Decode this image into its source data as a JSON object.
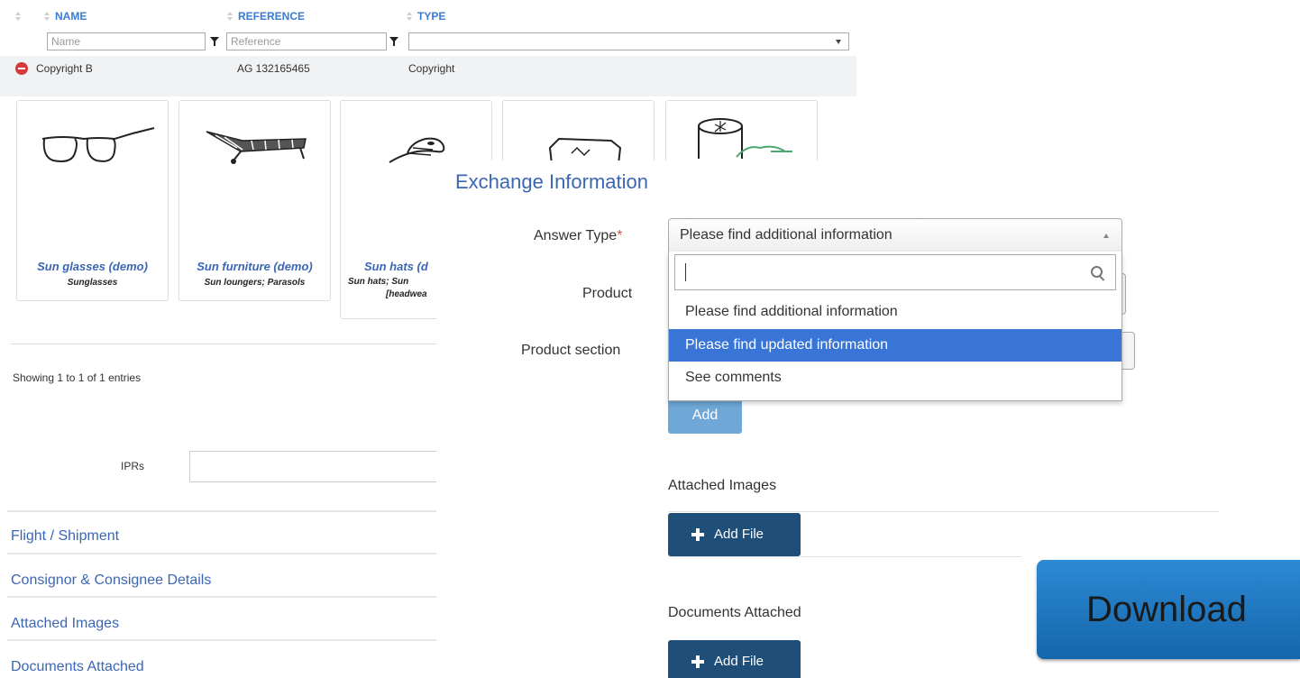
{
  "table": {
    "headers": [
      "NAME",
      "REFERENCE",
      "TYPE"
    ],
    "filters": {
      "name_placeholder": "Name",
      "reference_placeholder": "Reference",
      "type_value": ""
    },
    "rows": [
      {
        "name": "Copyright B",
        "reference": "AG 132165465",
        "type": "Copyright"
      }
    ]
  },
  "products": [
    {
      "title": "Sun glasses (demo)",
      "subtitle": "Sunglasses",
      "icon": "glasses-icon"
    },
    {
      "title": "Sun furniture (demo)",
      "subtitle": "Sun loungers; Parasols",
      "icon": "sun-lounger-icon"
    },
    {
      "title": "Sun hats (d",
      "subtitle": "Sun hats; Sun",
      "subtitle2": "[headwea",
      "icon": "sun-hat-icon"
    },
    {
      "icon": "sun-lotion-icon"
    },
    {
      "icon": "sun-cream-icon"
    }
  ],
  "pagination": {
    "info": "Showing 1 to 1 of 1 entries"
  },
  "iprs": {
    "label": "IPRs",
    "value": ""
  },
  "sections": [
    "Flight / Shipment",
    "Consignor & Consignee Details",
    "Attached Images",
    "Documents Attached"
  ],
  "exchange": {
    "title": "Exchange Information",
    "answer_type_label": "Answer Type",
    "required_mark": "*",
    "answer_type_value": "Please find additional information",
    "options": [
      "Please find additional information",
      "Please find updated information",
      "See comments"
    ],
    "selected_option": 1,
    "product_label": "Product",
    "product_section_label": "Product section",
    "add_label": "Add",
    "attached_images_label": "Attached Images",
    "documents_attached_label": "Documents Attached",
    "add_file_label": "Add File"
  },
  "download_label": "Download",
  "colors": {
    "link": "#3b66b5",
    "selected": "#3875d7",
    "file_button": "#1f4f78",
    "download": "#1f78c1"
  }
}
